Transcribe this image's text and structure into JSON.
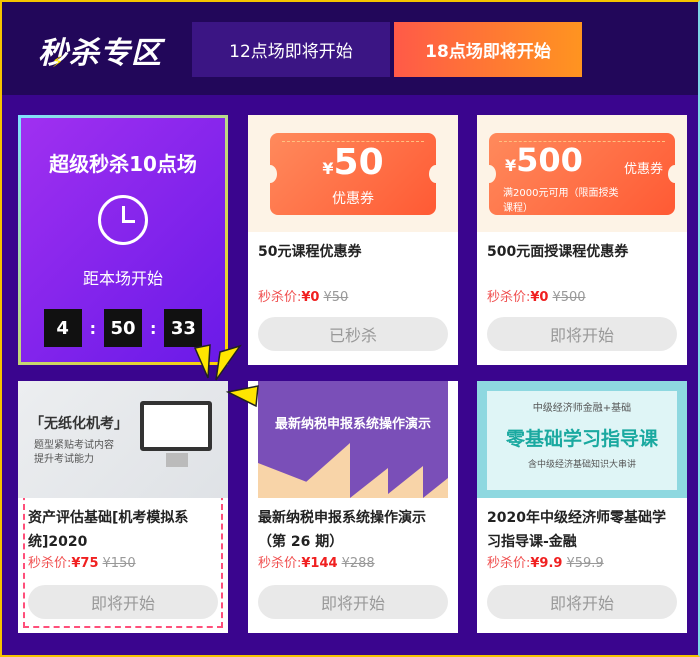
{
  "header": {
    "logo": "秒杀专区",
    "tabs": [
      {
        "label": "12点场即将开始"
      },
      {
        "label": "18点场即将开始"
      }
    ]
  },
  "featured": {
    "title": "超级秒杀10点场",
    "subtitle": "距本场开始",
    "countdown": [
      "4",
      "50",
      "33"
    ],
    "separator": ":"
  },
  "price_label": "秒杀价:",
  "cards": [
    {
      "coupon_currency": "¥",
      "coupon_amount": "50",
      "coupon_text": "优惠券",
      "title": "50元课程优惠券",
      "price": "¥0",
      "original": "¥50",
      "button": "已秒杀"
    },
    {
      "coupon_currency": "¥",
      "coupon_amount": "500",
      "coupon_text": "优惠券",
      "coupon_note": "满2000元可用（限面授类课程）",
      "title": "500元面授课程优惠券",
      "price": "¥0",
      "original": "¥500",
      "button": "即将开始"
    },
    {
      "image_title": "「无纸化机考」",
      "image_sub1": "题型紧贴考试内容",
      "image_sub2": "提升考试能力",
      "title": "资产评估基础[机考模拟系统]2020",
      "price": "¥75",
      "original": "¥150",
      "button": "即将开始"
    },
    {
      "image_title": "最新纳税申报系统操作演示",
      "title": "最新纳税申报系统操作演示（第 26 期）",
      "price": "¥144",
      "original": "¥288",
      "button": "即将开始"
    },
    {
      "image_top": "中级经济师金融+基础",
      "image_title": "零基础学习指导课",
      "image_sub": "含中级经济基础知识大串讲",
      "title": "2020年中级经济师零基础学习指导课-金融",
      "price": "¥9.9",
      "original": "¥59.9",
      "button": "即将开始"
    }
  ]
}
